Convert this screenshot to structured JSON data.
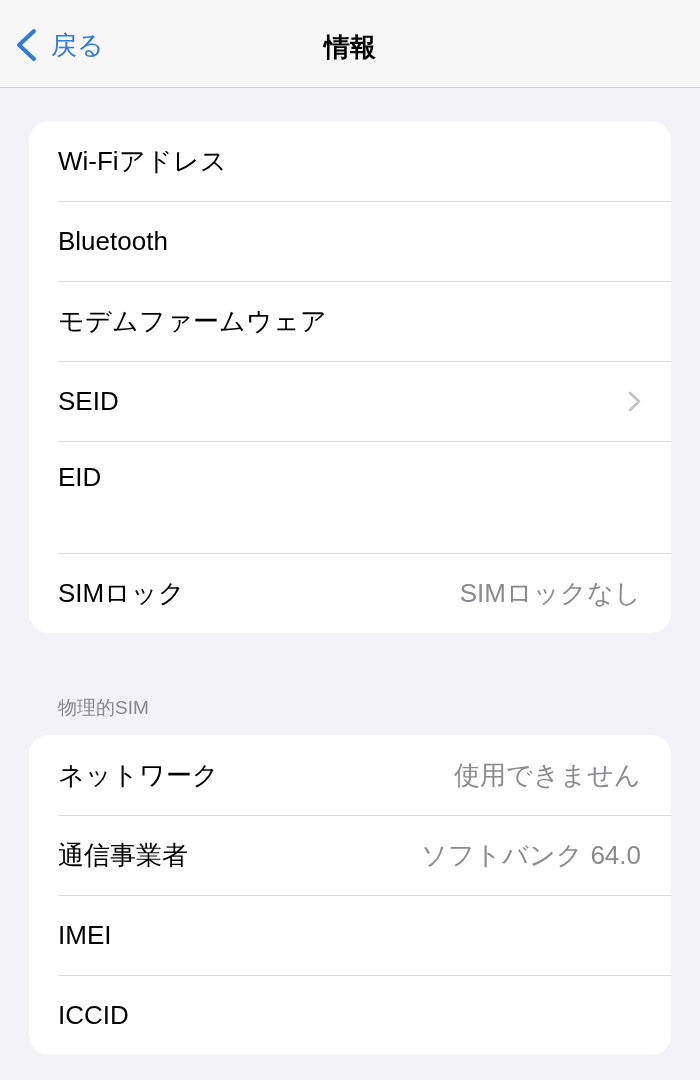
{
  "nav_bar": {
    "back_label": "戻る",
    "title": "情報"
  },
  "sections": [
    {
      "rows": [
        {
          "kind": "detail",
          "label": "Wi-Fiアドレス"
        },
        {
          "kind": "detail",
          "label": "Bluetooth"
        },
        {
          "kind": "detail",
          "label": "モデムファームウェア"
        },
        {
          "kind": "link",
          "label": "SEID"
        },
        {
          "kind": "stacked",
          "label": "EID"
        },
        {
          "kind": "detail",
          "label": "SIMロック",
          "value": "SIMロックなし"
        }
      ]
    },
    {
      "header": "物理的SIM",
      "rows": [
        {
          "kind": "detail",
          "label": "ネットワーク",
          "value": "使用できません"
        },
        {
          "kind": "detail",
          "label": "通信事業者",
          "value": "ソフトバンク 64.0"
        },
        {
          "kind": "detail",
          "label": "IMEI"
        },
        {
          "kind": "detail",
          "label": "ICCID"
        }
      ]
    }
  ]
}
